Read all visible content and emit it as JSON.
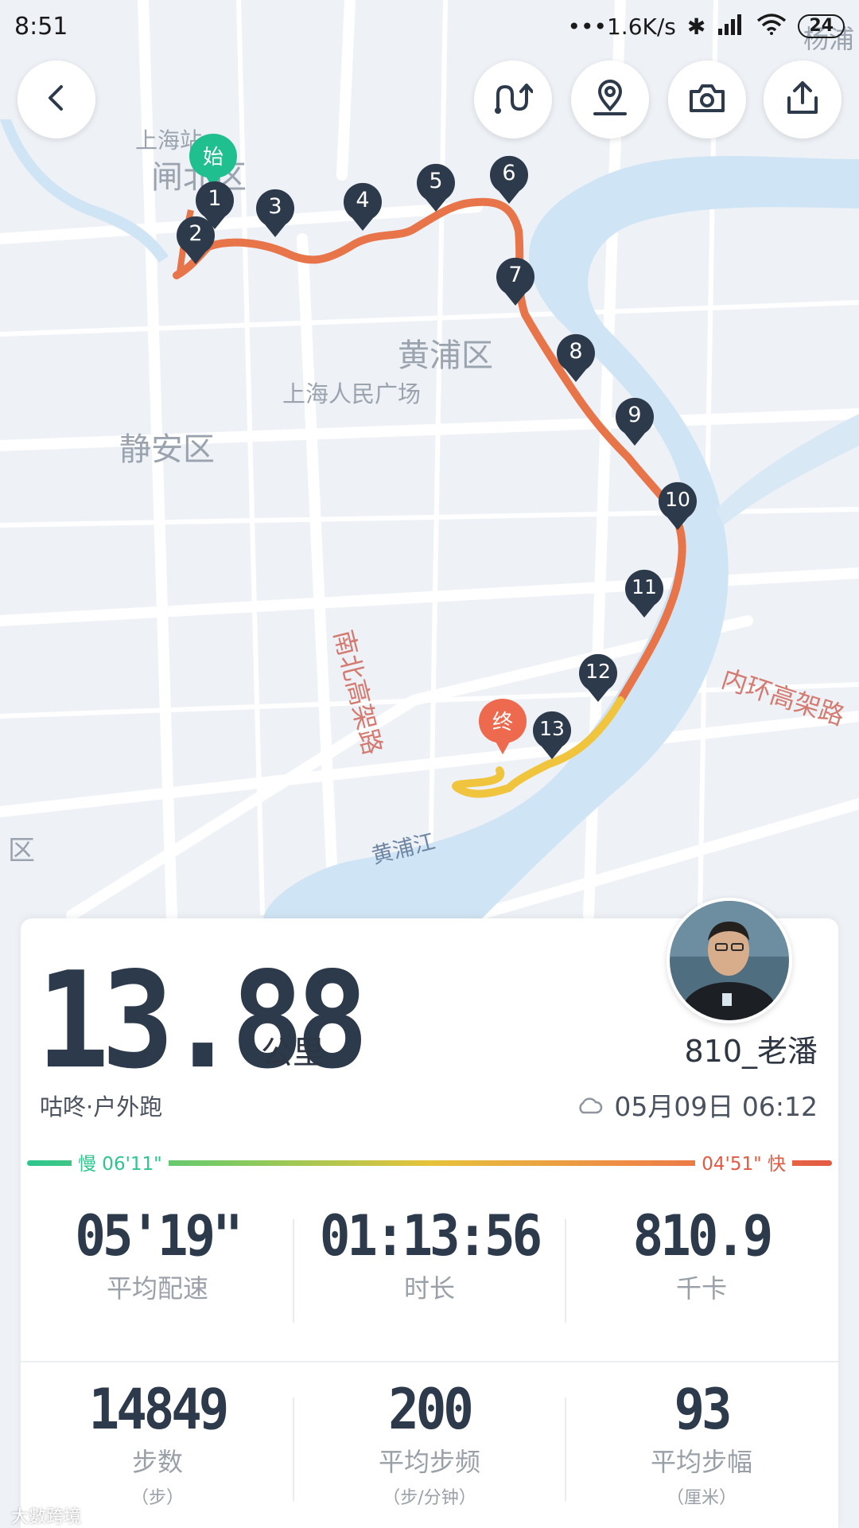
{
  "status_bar": {
    "time": "8:51",
    "network_speed": "•••1.6K/s",
    "battery": "24",
    "icons": [
      "bluetooth-icon",
      "signal-icon",
      "wifi-icon",
      "battery-icon"
    ]
  },
  "toolbar": {
    "back": "back-icon",
    "actions": [
      "route-toggle-icon",
      "location-pin-icon",
      "camera-icon",
      "share-icon"
    ]
  },
  "map": {
    "labels": {
      "shanghai_station": "上海站",
      "zhabei": "闸北区",
      "huangpu_district": "黄浦区",
      "peoples_square": "上海人民广场",
      "jingan": "静安区",
      "nanbei": "南北高架路",
      "inner_ring": "内环高架路",
      "huangpu_river": "黄浦江",
      "edge_left": "区",
      "edge_top_right": "杨浦"
    },
    "start_marker": "始",
    "end_marker": "终",
    "km_markers": [
      "1",
      "2",
      "3",
      "4",
      "5",
      "6",
      "7",
      "8",
      "9",
      "10",
      "11",
      "12",
      "13"
    ]
  },
  "summary": {
    "distance": "13.88",
    "unit": "公里",
    "username": "810_老潘",
    "activity": "咕咚·户外跑",
    "date": "05月09日 06:12",
    "weather_icon": "cloud-icon"
  },
  "pace_bar": {
    "slow_label": "慢 06'11\"",
    "fast_label": "04'51\" 快"
  },
  "stats": [
    {
      "value": "05'19\"",
      "label": "平均配速",
      "sub": ""
    },
    {
      "value": "01:13:56",
      "label": "时长",
      "sub": ""
    },
    {
      "value": "810.9",
      "label": "千卡",
      "sub": ""
    },
    {
      "value": "14849",
      "label": "步数",
      "sub": "（步）"
    },
    {
      "value": "200",
      "label": "平均步频",
      "sub": "（步/分钟）"
    },
    {
      "value": "93",
      "label": "平均步幅",
      "sub": "（厘米）"
    }
  ],
  "watermark": "大數跨境",
  "colors": {
    "route_start": "#e8744a",
    "route_end": "#f0c43c",
    "start_pin": "#1fbf8f",
    "end_pin": "#ee6a4f",
    "km_pin": "#2c3a4b",
    "river": "#cfe4f4"
  }
}
